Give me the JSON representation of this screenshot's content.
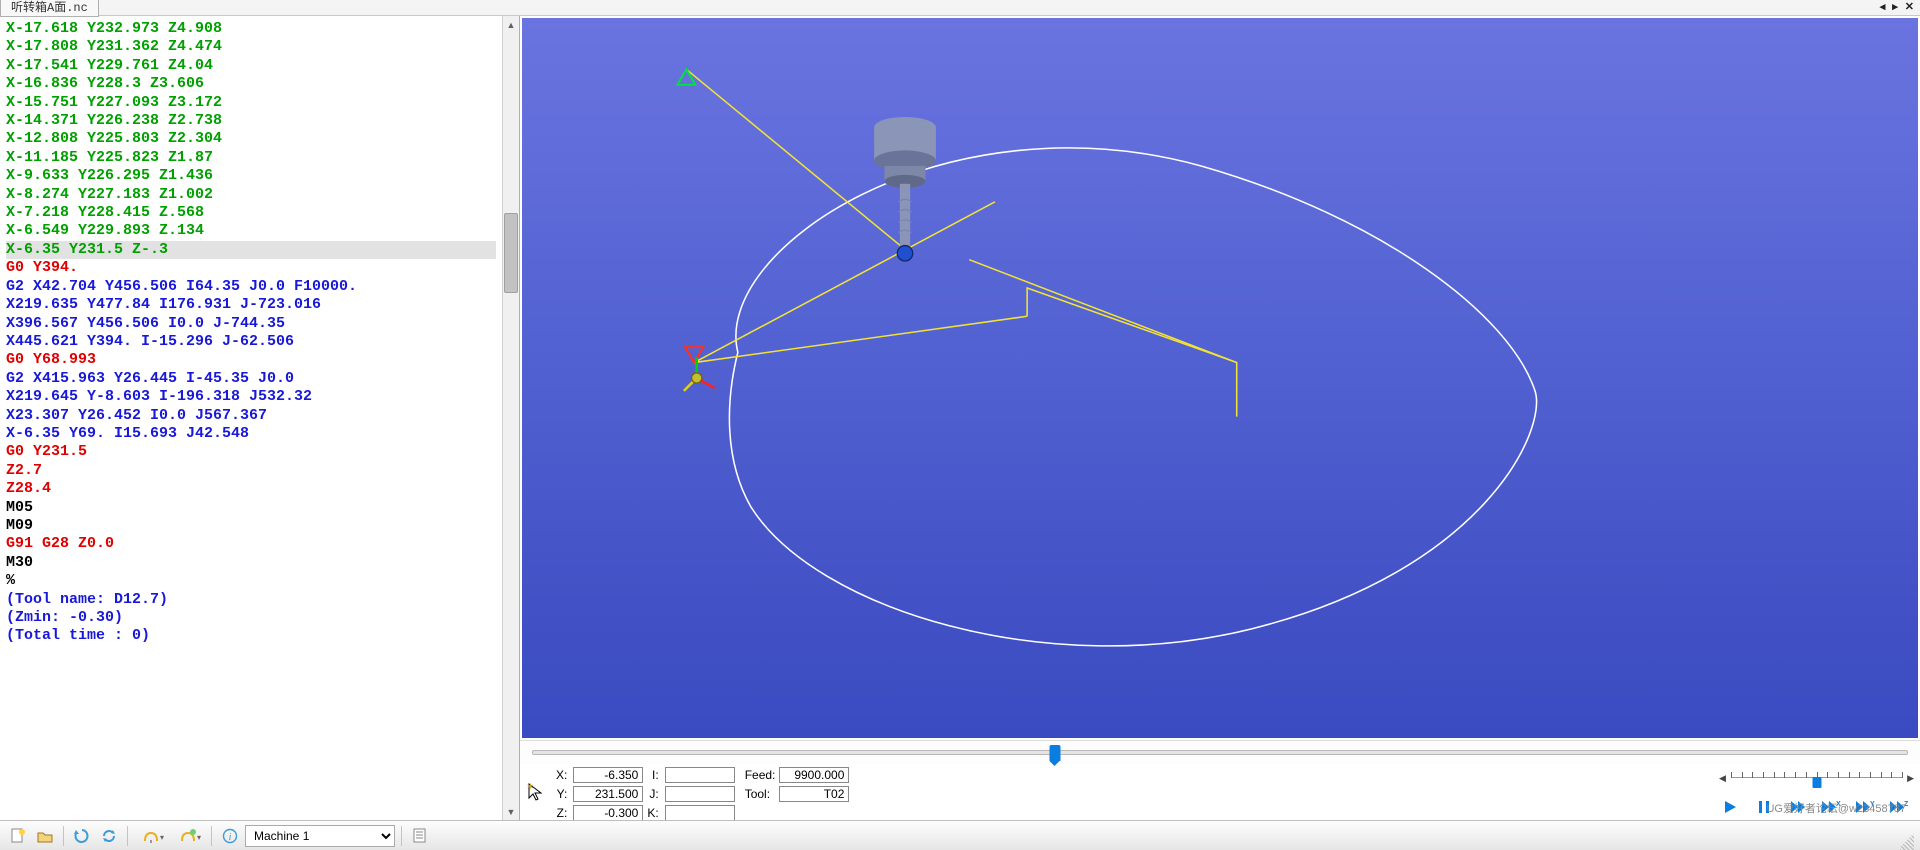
{
  "tab": {
    "label": "听转箱A面.nc"
  },
  "win_controls": {
    "prev": "◂",
    "next": "▸",
    "close": "✕"
  },
  "code_lines": [
    {
      "cls": "c-green",
      "text": "X-17.618 Y232.973 Z4.908"
    },
    {
      "cls": "c-green",
      "text": "X-17.808 Y231.362 Z4.474"
    },
    {
      "cls": "c-green",
      "text": "X-17.541 Y229.761 Z4.04"
    },
    {
      "cls": "c-green",
      "text": "X-16.836 Y228.3 Z3.606"
    },
    {
      "cls": "c-green",
      "text": "X-15.751 Y227.093 Z3.172"
    },
    {
      "cls": "c-green",
      "text": "X-14.371 Y226.238 Z2.738"
    },
    {
      "cls": "c-green",
      "text": "X-12.808 Y225.803 Z2.304"
    },
    {
      "cls": "c-green",
      "text": "X-11.185 Y225.823 Z1.87"
    },
    {
      "cls": "c-green",
      "text": "X-9.633 Y226.295 Z1.436"
    },
    {
      "cls": "c-green",
      "text": "X-8.274 Y227.183 Z1.002"
    },
    {
      "cls": "c-green",
      "text": "X-7.218 Y228.415 Z.568"
    },
    {
      "cls": "c-green",
      "text": "X-6.549 Y229.893 Z.134"
    },
    {
      "cls": "c-hl",
      "text": "X-6.35 Y231.5 Z-.3"
    },
    {
      "cls": "c-red",
      "text": "G0 Y394."
    },
    {
      "cls": "c-blue",
      "text": "G2 X42.704 Y456.506 I64.35 J0.0 F10000."
    },
    {
      "cls": "c-blue",
      "text": "X219.635 Y477.84 I176.931 J-723.016"
    },
    {
      "cls": "c-blue",
      "text": "X396.567 Y456.506 I0.0 J-744.35"
    },
    {
      "cls": "c-blue",
      "text": "X445.621 Y394. I-15.296 J-62.506"
    },
    {
      "cls": "c-red",
      "text": "G0 Y68.993"
    },
    {
      "cls": "c-blue",
      "text": "G2 X415.963 Y26.445 I-45.35 J0.0"
    },
    {
      "cls": "c-blue",
      "text": "X219.645 Y-8.603 I-196.318 J532.32"
    },
    {
      "cls": "c-blue",
      "text": "X23.307 Y26.452 I0.0 J567.367"
    },
    {
      "cls": "c-blue",
      "text": "X-6.35 Y69. I15.693 J42.548"
    },
    {
      "cls": "c-red",
      "text": "G0 Y231.5"
    },
    {
      "cls": "c-red",
      "text": "Z2.7"
    },
    {
      "cls": "c-red",
      "text": "Z28.4"
    },
    {
      "cls": "c-black",
      "text": "M05"
    },
    {
      "cls": "c-black",
      "text": "M09"
    },
    {
      "cls": "c-red",
      "text": "G91 G28 Z0.0"
    },
    {
      "cls": "c-black",
      "text": "M30"
    },
    {
      "cls": "c-black",
      "text": "%"
    },
    {
      "cls": "c-blue",
      "text": "(Tool name: D12.7)"
    },
    {
      "cls": "c-blue",
      "text": "(Zmin: -0.30)"
    },
    {
      "cls": "c-blue",
      "text": "(Total time : 0)"
    }
  ],
  "slider": {
    "percent": 38
  },
  "coords": {
    "x_label": "X:",
    "x_value": "-6.350",
    "y_label": "Y:",
    "y_value": "231.500",
    "z_label": "Z:",
    "z_value": "-0.300",
    "i_label": "I:",
    "i_value": "",
    "j_label": "J:",
    "j_value": "",
    "k_label": "K:",
    "k_value": ""
  },
  "feed": {
    "feed_label": "Feed:",
    "feed_value": "9900.000",
    "tool_label": "Tool:",
    "tool_value": "T02"
  },
  "speed": {
    "percent": 50
  },
  "machine_select": "Machine 1",
  "watermark": "UG爱好者论坛@w23458787"
}
